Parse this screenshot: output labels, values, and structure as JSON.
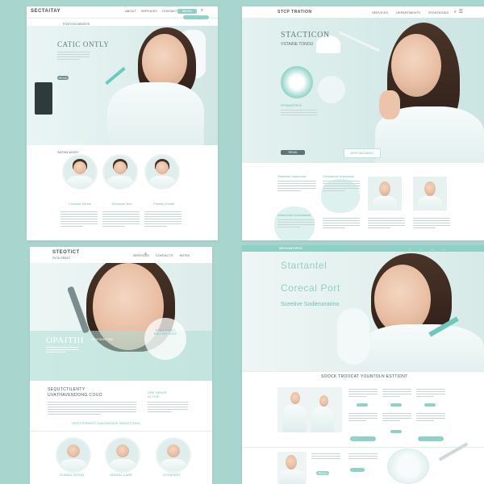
{
  "colors": {
    "accent": "#8fd0c6",
    "background": "#a9d5cf",
    "text": "#5f7d80"
  },
  "panel1": {
    "logo": "SECTAITAY",
    "subtitle": "POSITION WEBSITE",
    "nav": [
      "ABOUT",
      "SERVICES",
      "CONTACT"
    ],
    "nav_button": "BOOK",
    "hero_title": "CATIC ONTLY",
    "hero_button": "READ",
    "section_title": "SATHN WORY",
    "captions": [
      "Ceraded Nerice",
      "Sinetrivre Bes",
      "Penetin Foralit"
    ]
  },
  "panel2": {
    "logo": "STCP TRATION",
    "nav": [
      "SERVICES",
      "DEPARTMENTS",
      "STRATEGIES"
    ],
    "hero_title": "STACTICON",
    "hero_sub": "VSTAINE TONOU",
    "hero_caption": "STRANSTELE",
    "hero_button": "READ",
    "hero_button_right": "APPOINTMENT",
    "col_titles": [
      "Sterendo Iderinoure",
      "Ceredendo Adesnotal",
      "Unteorcilet Dosidalanie"
    ]
  },
  "panel3": {
    "logo": "STEOTICT",
    "subtitle": "OVTA GRADT",
    "nav": [
      "SERVICES",
      "CONTACTS",
      "INTRO"
    ],
    "hero_title": "OPAITIH",
    "hero_side": "SENTENO PAT",
    "badge": "POULLE DACY ROLT ENT ROOT",
    "section_title_1": "SEQUTCTILENTY",
    "section_title_2": "UVATHAVENDONG COUO",
    "side_title": "ORK DENGE ACTIVE",
    "tagline": "ORTOTERNENT DAVOIROSSE IVENOTYONS",
    "captions": [
      "CONSULTATION",
      "DENTAL CARE",
      "HYGIENIST"
    ]
  },
  "panel4": {
    "topbar_logo": "SEOUNTIFIC",
    "title1": "Startantel",
    "title2": "Corecal Port",
    "title3": "Sceetive Sodienorarino",
    "section_heading": "SOOCK TROOCAT YOUNTOLN ESTTIDNT",
    "button": "READ"
  }
}
